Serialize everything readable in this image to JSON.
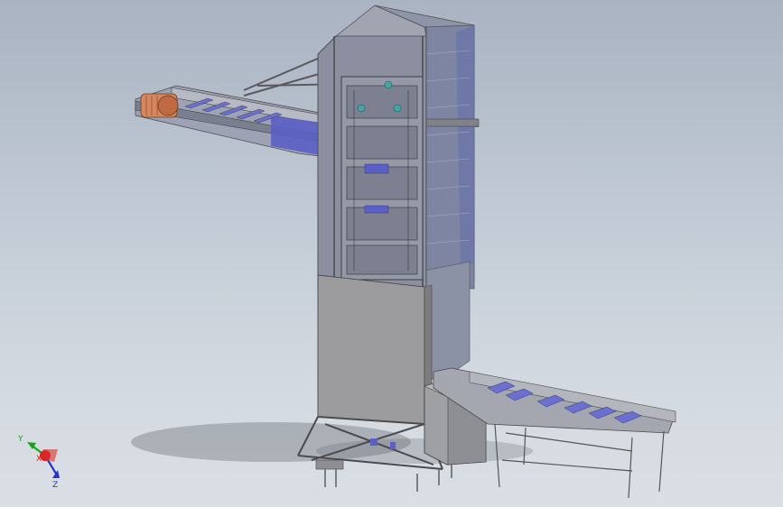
{
  "triad": {
    "y_label": "Y",
    "x_label": "X",
    "z_label": "Z"
  },
  "colors": {
    "background_top": "#a9b3c2",
    "background_bottom": "#dadfe5",
    "frame_gray": "#8d9096",
    "panel_gray": "#9a9a9c",
    "roller_blue": "#6a6fd0",
    "motor_orange": "#d7875e",
    "axis_y": "#1aa11a",
    "axis_x": "#e01919",
    "axis_z": "#2233cc"
  },
  "icons": {
    "triad": "coordinate-triad-icon"
  }
}
